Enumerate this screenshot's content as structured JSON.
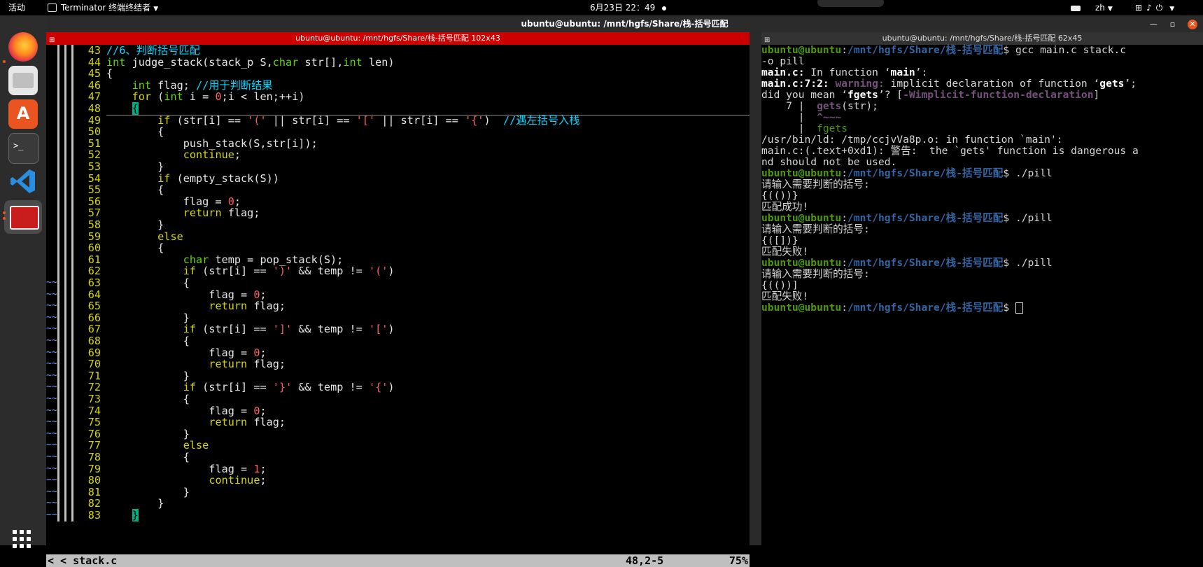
{
  "topbar": {
    "activities": "活动",
    "app_name": "Terminator 终端终结者",
    "clock": "6月23日  22：49",
    "lang": "zh"
  },
  "dock": {
    "icons": [
      "firefox-icon",
      "files-icon",
      "software-icon",
      "terminal-icon",
      "vscode-icon",
      "terminator-icon",
      "show-apps-icon"
    ]
  },
  "window": {
    "title": "ubuntu@ubuntu: /mnt/hgfs/Share/栈-括号匹配",
    "left_title": "ubuntu@ubuntu: /mnt/hgfs/Share/栈-括号匹配 102x43",
    "right_title": "ubuntu@ubuntu: /mnt/hgfs/Share/栈-括号匹配 62x45"
  },
  "vim": {
    "tildes": [
      false,
      false,
      false,
      false,
      false,
      false,
      false,
      false,
      false,
      false,
      false,
      false,
      false,
      false,
      false,
      false,
      false,
      false,
      false,
      false,
      true,
      true,
      true,
      true,
      true,
      true,
      true,
      true,
      true,
      true,
      true,
      true,
      true,
      true,
      true,
      true,
      true,
      true,
      true,
      true,
      true
    ],
    "lines": [
      {
        "n": "43",
        "segs": [
          {
            "t": "//6、判断括号匹配",
            "c": "cm"
          }
        ]
      },
      {
        "n": "44",
        "segs": [
          {
            "t": "int",
            "c": "ty"
          },
          {
            "t": " judge_stack(stack_p S,",
            "c": ""
          },
          {
            "t": "char",
            "c": "ty"
          },
          {
            "t": " str[],",
            "c": ""
          },
          {
            "t": "int",
            "c": "ty"
          },
          {
            "t": " len)",
            "c": ""
          }
        ]
      },
      {
        "n": "45",
        "segs": [
          {
            "t": "{",
            "c": ""
          }
        ]
      },
      {
        "n": "46",
        "segs": [
          {
            "t": "    ",
            "c": ""
          },
          {
            "t": "int",
            "c": "ty"
          },
          {
            "t": " flag; ",
            "c": ""
          },
          {
            "t": "//用于判断结果",
            "c": "cm"
          }
        ]
      },
      {
        "n": "47",
        "segs": [
          {
            "t": "    ",
            "c": ""
          },
          {
            "t": "for",
            "c": "kw"
          },
          {
            "t": " (",
            "c": ""
          },
          {
            "t": "int",
            "c": "ty"
          },
          {
            "t": " i = ",
            "c": ""
          },
          {
            "t": "0",
            "c": "st"
          },
          {
            "t": ";i < len;++i)",
            "c": ""
          }
        ]
      },
      {
        "n": "48",
        "segs": [
          {
            "t": "    ",
            "c": ""
          },
          {
            "t": "{",
            "c": "br"
          }
        ]
      },
      {
        "n": "49",
        "segs": [
          {
            "t": "        ",
            "c": ""
          },
          {
            "t": "if",
            "c": "kw"
          },
          {
            "t": " (str[i] == ",
            "c": ""
          },
          {
            "t": "'('",
            "c": "st"
          },
          {
            "t": " || str[i] == ",
            "c": ""
          },
          {
            "t": "'['",
            "c": "st"
          },
          {
            "t": " || str[i] == ",
            "c": ""
          },
          {
            "t": "'{'",
            "c": "st"
          },
          {
            "t": ")  ",
            "c": ""
          },
          {
            "t": "//遇左括号入栈",
            "c": "cm"
          }
        ]
      },
      {
        "n": "50",
        "segs": [
          {
            "t": "        {",
            "c": ""
          }
        ]
      },
      {
        "n": "51",
        "segs": [
          {
            "t": "            push_stack(S,str[i]);",
            "c": ""
          }
        ]
      },
      {
        "n": "52",
        "segs": [
          {
            "t": "            ",
            "c": ""
          },
          {
            "t": "continue",
            "c": "kw"
          },
          {
            "t": ";",
            "c": ""
          }
        ]
      },
      {
        "n": "53",
        "segs": [
          {
            "t": "        }",
            "c": ""
          }
        ]
      },
      {
        "n": "54",
        "segs": [
          {
            "t": "        ",
            "c": ""
          },
          {
            "t": "if",
            "c": "kw"
          },
          {
            "t": " (empty_stack(S))",
            "c": ""
          }
        ]
      },
      {
        "n": "55",
        "segs": [
          {
            "t": "        {",
            "c": ""
          }
        ]
      },
      {
        "n": "56",
        "segs": [
          {
            "t": "            flag = ",
            "c": ""
          },
          {
            "t": "0",
            "c": "st"
          },
          {
            "t": ";",
            "c": ""
          }
        ]
      },
      {
        "n": "57",
        "segs": [
          {
            "t": "            ",
            "c": ""
          },
          {
            "t": "return",
            "c": "kw"
          },
          {
            "t": " flag;",
            "c": ""
          }
        ]
      },
      {
        "n": "58",
        "segs": [
          {
            "t": "        }",
            "c": ""
          }
        ]
      },
      {
        "n": "59",
        "segs": [
          {
            "t": "        ",
            "c": ""
          },
          {
            "t": "else",
            "c": "kw"
          }
        ]
      },
      {
        "n": "60",
        "segs": [
          {
            "t": "        {",
            "c": ""
          }
        ]
      },
      {
        "n": "61",
        "segs": [
          {
            "t": "            ",
            "c": ""
          },
          {
            "t": "char",
            "c": "ty"
          },
          {
            "t": " temp = pop_stack(S);",
            "c": ""
          }
        ]
      },
      {
        "n": "62",
        "segs": [
          {
            "t": "            ",
            "c": ""
          },
          {
            "t": "if",
            "c": "kw"
          },
          {
            "t": " (str[i] == ",
            "c": ""
          },
          {
            "t": "')'",
            "c": "st"
          },
          {
            "t": " && temp != ",
            "c": ""
          },
          {
            "t": "'('",
            "c": "st"
          },
          {
            "t": ")",
            "c": ""
          }
        ]
      },
      {
        "n": "63",
        "segs": [
          {
            "t": "            {",
            "c": ""
          }
        ]
      },
      {
        "n": "64",
        "segs": [
          {
            "t": "                flag = ",
            "c": ""
          },
          {
            "t": "0",
            "c": "st"
          },
          {
            "t": ";",
            "c": ""
          }
        ]
      },
      {
        "n": "65",
        "segs": [
          {
            "t": "                ",
            "c": ""
          },
          {
            "t": "return",
            "c": "kw"
          },
          {
            "t": " flag;",
            "c": ""
          }
        ]
      },
      {
        "n": "66",
        "segs": [
          {
            "t": "            }",
            "c": ""
          }
        ]
      },
      {
        "n": "67",
        "segs": [
          {
            "t": "            ",
            "c": ""
          },
          {
            "t": "if",
            "c": "kw"
          },
          {
            "t": " (str[i] == ",
            "c": ""
          },
          {
            "t": "']'",
            "c": "st"
          },
          {
            "t": " && temp != ",
            "c": ""
          },
          {
            "t": "'['",
            "c": "st"
          },
          {
            "t": ")",
            "c": ""
          }
        ]
      },
      {
        "n": "68",
        "segs": [
          {
            "t": "            {",
            "c": ""
          }
        ]
      },
      {
        "n": "69",
        "segs": [
          {
            "t": "                flag = ",
            "c": ""
          },
          {
            "t": "0",
            "c": "st"
          },
          {
            "t": ";",
            "c": ""
          }
        ]
      },
      {
        "n": "70",
        "segs": [
          {
            "t": "                ",
            "c": ""
          },
          {
            "t": "return",
            "c": "kw"
          },
          {
            "t": " flag;",
            "c": ""
          }
        ]
      },
      {
        "n": "71",
        "segs": [
          {
            "t": "            }",
            "c": ""
          }
        ]
      },
      {
        "n": "72",
        "segs": [
          {
            "t": "            ",
            "c": ""
          },
          {
            "t": "if",
            "c": "kw"
          },
          {
            "t": " (str[i] == ",
            "c": ""
          },
          {
            "t": "'}'",
            "c": "st"
          },
          {
            "t": " && temp != ",
            "c": ""
          },
          {
            "t": "'{'",
            "c": "st"
          },
          {
            "t": ")",
            "c": ""
          }
        ]
      },
      {
        "n": "73",
        "segs": [
          {
            "t": "            {",
            "c": ""
          }
        ]
      },
      {
        "n": "74",
        "segs": [
          {
            "t": "                flag = ",
            "c": ""
          },
          {
            "t": "0",
            "c": "st"
          },
          {
            "t": ";",
            "c": ""
          }
        ]
      },
      {
        "n": "75",
        "segs": [
          {
            "t": "                ",
            "c": ""
          },
          {
            "t": "return",
            "c": "kw"
          },
          {
            "t": " flag;",
            "c": ""
          }
        ]
      },
      {
        "n": "76",
        "segs": [
          {
            "t": "            }",
            "c": ""
          }
        ]
      },
      {
        "n": "77",
        "segs": [
          {
            "t": "            ",
            "c": ""
          },
          {
            "t": "else",
            "c": "kw"
          }
        ]
      },
      {
        "n": "78",
        "segs": [
          {
            "t": "            {",
            "c": ""
          }
        ]
      },
      {
        "n": "79",
        "segs": [
          {
            "t": "                flag = ",
            "c": ""
          },
          {
            "t": "1",
            "c": "st"
          },
          {
            "t": ";",
            "c": ""
          }
        ]
      },
      {
        "n": "80",
        "segs": [
          {
            "t": "                ",
            "c": ""
          },
          {
            "t": "continue",
            "c": "kw"
          },
          {
            "t": ";",
            "c": ""
          }
        ]
      },
      {
        "n": "81",
        "segs": [
          {
            "t": "            }",
            "c": ""
          }
        ]
      },
      {
        "n": "82",
        "segs": [
          {
            "t": "        }",
            "c": ""
          }
        ]
      },
      {
        "n": "83",
        "segs": [
          {
            "t": "    ",
            "c": ""
          },
          {
            "t": "}",
            "c": "br"
          }
        ]
      }
    ],
    "status": {
      "filename": "< < stack.c",
      "position": "48,2-5",
      "percent": "75%"
    }
  },
  "terminal": {
    "lines": [
      [
        {
          "t": "ubuntu@ubuntu",
          "c": "pu"
        },
        {
          "t": ":",
          "c": ""
        },
        {
          "t": "/mnt/hgfs/Share/栈-括号匹配",
          "c": "pp"
        },
        {
          "t": "$ gcc main.c stack.c",
          "c": ""
        }
      ],
      [
        {
          "t": "-o pill",
          "c": ""
        }
      ],
      [
        {
          "t": "main.c:",
          "c": "b"
        },
        {
          "t": " In function ‘",
          "c": ""
        },
        {
          "t": "main",
          "c": "b"
        },
        {
          "t": "’:",
          "c": ""
        }
      ],
      [
        {
          "t": "main.c:7:2:",
          "c": "b"
        },
        {
          "t": " ",
          "c": ""
        },
        {
          "t": "warning:",
          "c": "wn"
        },
        {
          "t": " implicit declaration of function ‘",
          "c": ""
        },
        {
          "t": "gets",
          "c": "b"
        },
        {
          "t": "’;",
          "c": ""
        }
      ],
      [
        {
          "t": "did you mean ‘",
          "c": ""
        },
        {
          "t": "fgets",
          "c": "b"
        },
        {
          "t": "’? [",
          "c": ""
        },
        {
          "t": "-Wimplicit-function-declaration",
          "c": "wf"
        },
        {
          "t": "]",
          "c": ""
        }
      ],
      [
        {
          "t": "    7 | ",
          "c": ""
        },
        {
          "t": " gets",
          "c": "wf"
        },
        {
          "t": "(str);",
          "c": ""
        }
      ],
      [
        {
          "t": "      |  ",
          "c": ""
        },
        {
          "t": "^~~~",
          "c": "wf"
        }
      ],
      [
        {
          "t": "      |  ",
          "c": ""
        },
        {
          "t": "fgets",
          "c": "gr"
        }
      ],
      [
        {
          "t": "/usr/bin/ld: /tmp/ccjvVa8p.o: in function `main':",
          "c": ""
        }
      ],
      [
        {
          "t": "main.c:(.text+0xd1): 警告:  the `gets' function is dangerous a",
          "c": ""
        }
      ],
      [
        {
          "t": "nd should not be used.",
          "c": ""
        }
      ],
      [
        {
          "t": "ubuntu@ubuntu",
          "c": "pu"
        },
        {
          "t": ":",
          "c": ""
        },
        {
          "t": "/mnt/hgfs/Share/栈-括号匹配",
          "c": "pp"
        },
        {
          "t": "$ ./pill",
          "c": ""
        }
      ],
      [
        {
          "t": "请输入需要判断的括号:",
          "c": ""
        }
      ],
      [
        {
          "t": "{(())}",
          "c": ""
        }
      ],
      [
        {
          "t": "匹配成功!",
          "c": ""
        }
      ],
      [
        {
          "t": "ubuntu@ubuntu",
          "c": "pu"
        },
        {
          "t": ":",
          "c": ""
        },
        {
          "t": "/mnt/hgfs/Share/栈-括号匹配",
          "c": "pp"
        },
        {
          "t": "$ ./pill",
          "c": ""
        }
      ],
      [
        {
          "t": "请输入需要判断的括号:",
          "c": ""
        }
      ],
      [
        {
          "t": "{([])}",
          "c": ""
        }
      ],
      [
        {
          "t": "匹配失败!",
          "c": ""
        }
      ],
      [
        {
          "t": "ubuntu@ubuntu",
          "c": "pu"
        },
        {
          "t": ":",
          "c": ""
        },
        {
          "t": "/mnt/hgfs/Share/栈-括号匹配",
          "c": "pp"
        },
        {
          "t": "$ ./pill",
          "c": ""
        }
      ],
      [
        {
          "t": "请输入需要判断的括号:",
          "c": ""
        }
      ],
      [
        {
          "t": "{(())]",
          "c": ""
        }
      ],
      [
        {
          "t": "匹配失败!",
          "c": ""
        }
      ],
      [
        {
          "t": "ubuntu@ubuntu",
          "c": "pu"
        },
        {
          "t": ":",
          "c": ""
        },
        {
          "t": "/mnt/hgfs/Share/栈-括号匹配",
          "c": "pp"
        },
        {
          "t": "$ ",
          "c": ""
        }
      ]
    ]
  }
}
